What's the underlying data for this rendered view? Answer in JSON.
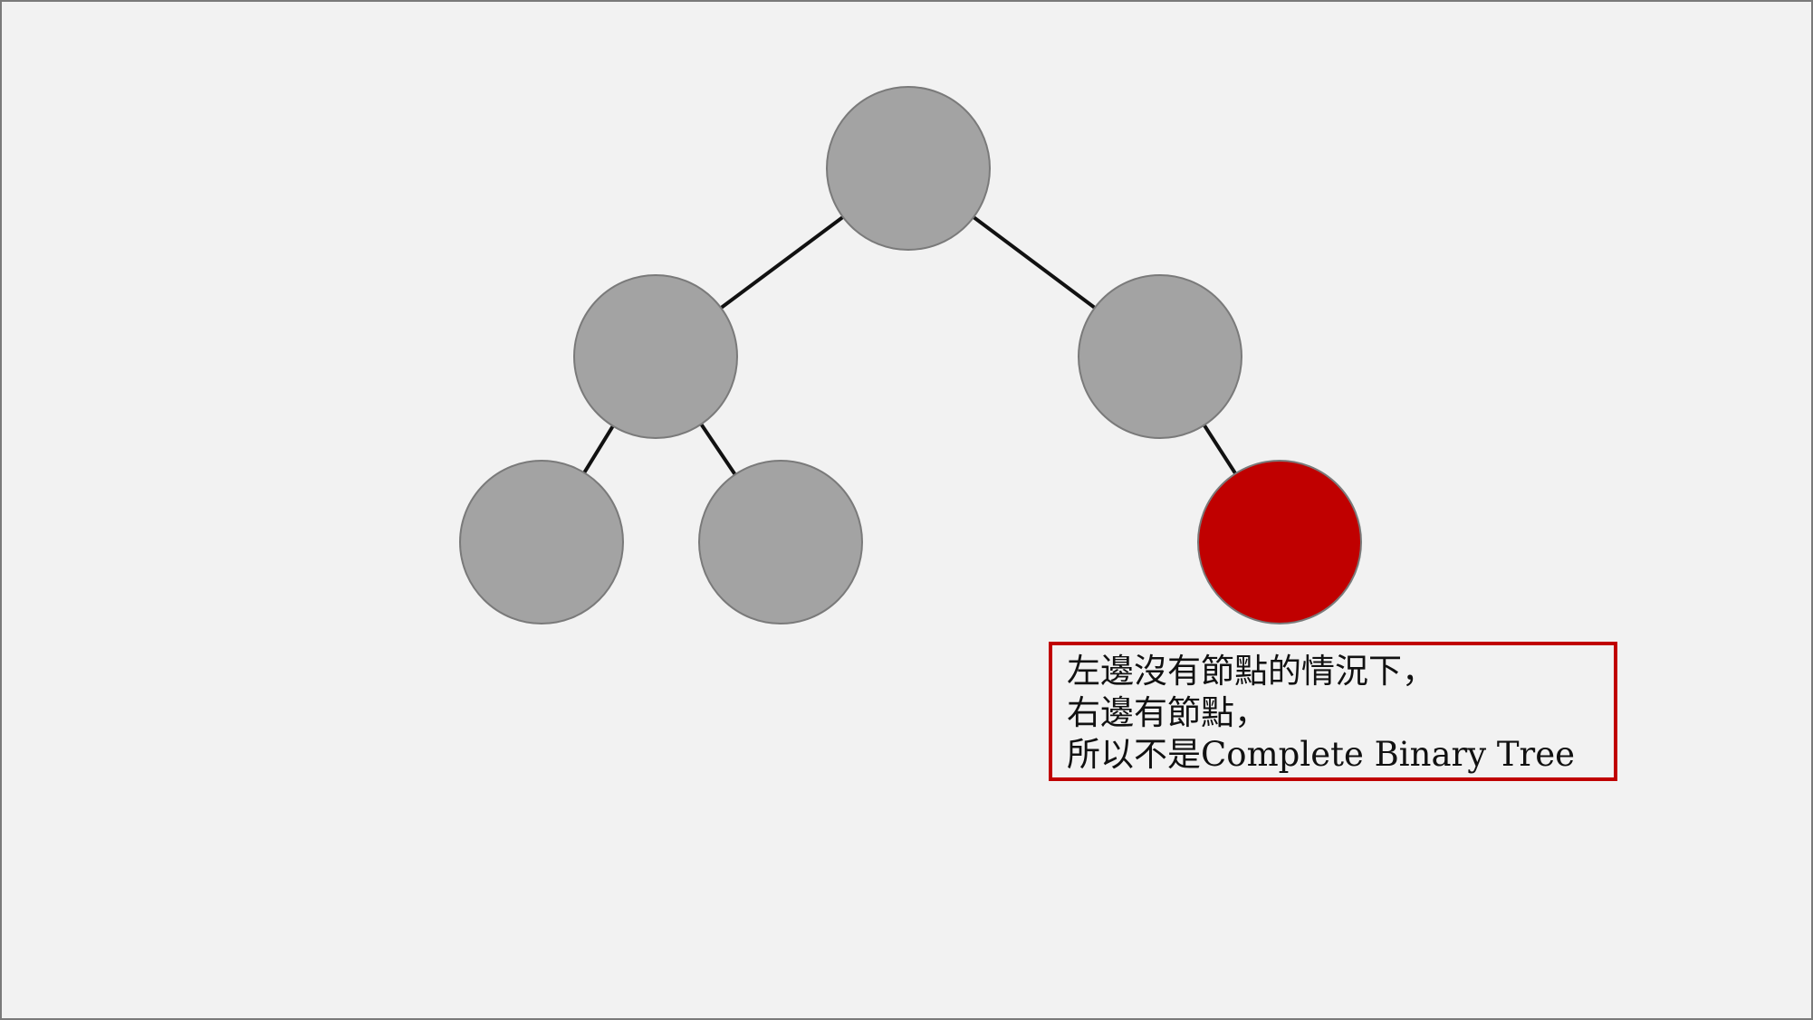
{
  "colors": {
    "background": "#f2f2f2",
    "node_fill": "#a3a3a3",
    "node_stroke": "#7a7a7a",
    "highlight_fill": "#c00000",
    "edge": "#111111",
    "note_border": "#c00000"
  },
  "tree": {
    "nodes": [
      {
        "id": "root",
        "level": 0,
        "highlighted": false
      },
      {
        "id": "left",
        "level": 1,
        "highlighted": false
      },
      {
        "id": "right",
        "level": 1,
        "highlighted": false
      },
      {
        "id": "left-left",
        "level": 2,
        "highlighted": false
      },
      {
        "id": "left-right",
        "level": 2,
        "highlighted": false
      },
      {
        "id": "right-right",
        "level": 2,
        "highlighted": true
      }
    ],
    "edges": [
      {
        "from": "root",
        "to": "left"
      },
      {
        "from": "root",
        "to": "right"
      },
      {
        "from": "left",
        "to": "left-left"
      },
      {
        "from": "left",
        "to": "left-right"
      },
      {
        "from": "right",
        "to": "right-right"
      }
    ]
  },
  "note": {
    "lines": [
      "左邊沒有節點的情況下，",
      "右邊有節點，",
      "所以不是Complete Binary Tree"
    ]
  }
}
